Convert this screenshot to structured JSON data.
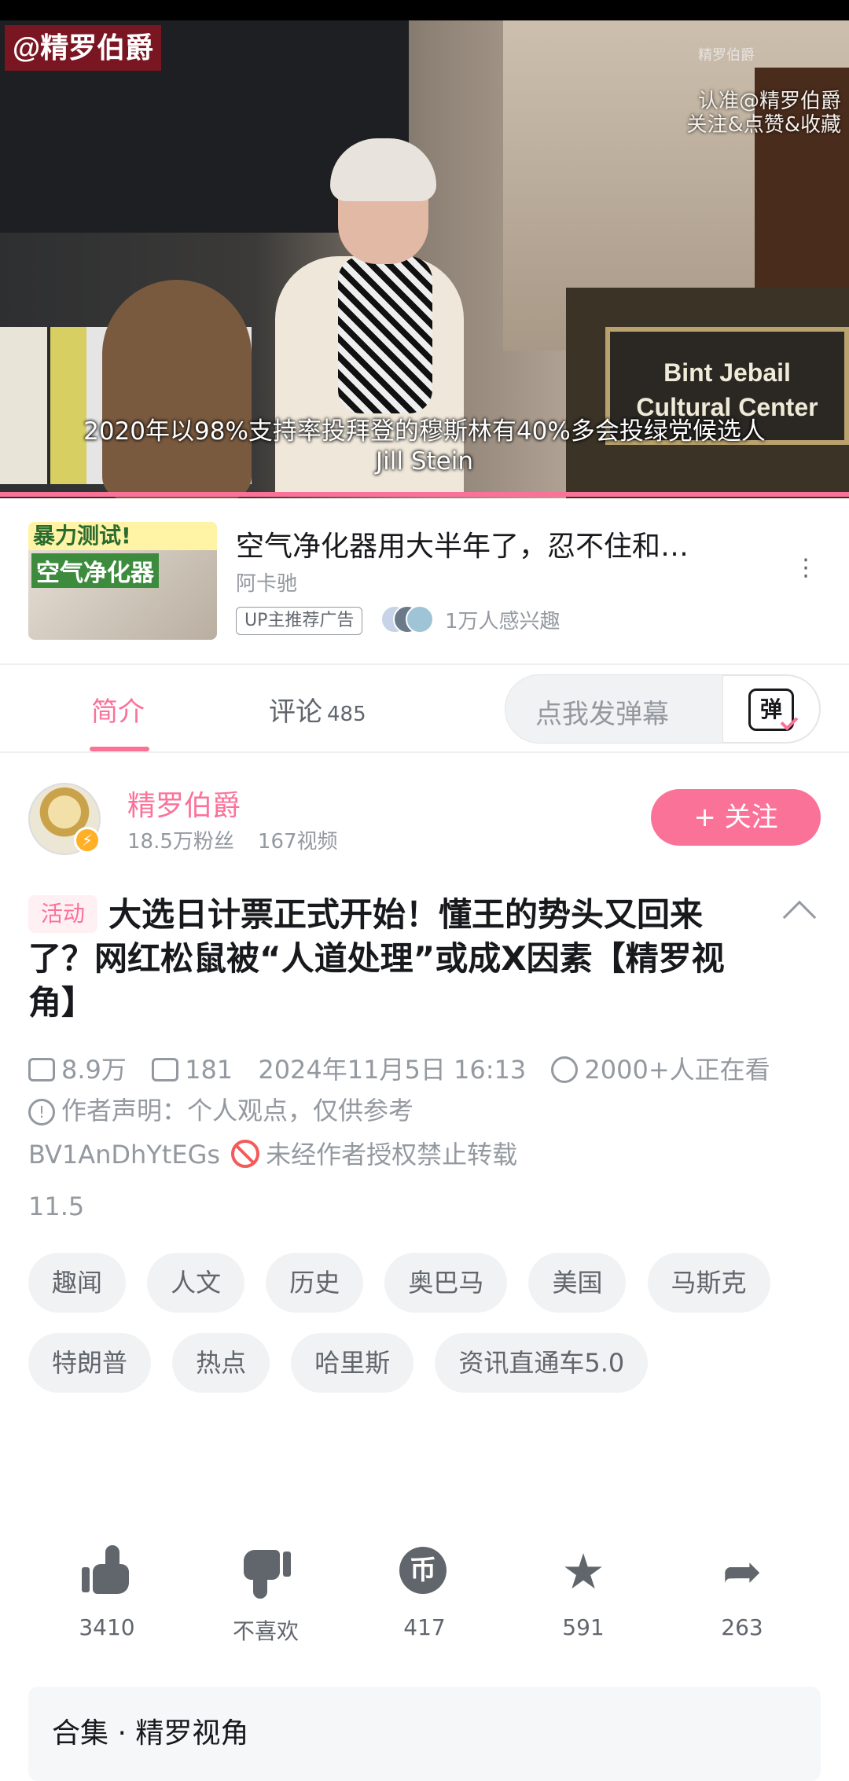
{
  "video": {
    "watermark": "@精罗伯爵",
    "watermark_top_right": "精罗伯爵",
    "watermark_lines": [
      "认准@精罗伯爵",
      "关注&点赞&收藏"
    ],
    "sign_lines": [
      "Bint Jebail",
      "Cultural Center"
    ],
    "subtitle_lines": [
      "2020年以98%支持率投拜登的穆斯林有40%多会投绿党候选人",
      "Jill Stein"
    ],
    "progress": 1.0
  },
  "ad": {
    "thumb_text_1": "暴力测试!",
    "thumb_text_2": "空气净化器",
    "title": "空气净化器用大半年了，忍不住和…",
    "author": "阿卡驰",
    "tag": "UP主推荐广告",
    "interest": "1万人感兴趣",
    "more": "⋮"
  },
  "tabs": {
    "intro": "简介",
    "comments": "评论",
    "comments_count": "485",
    "danmaku_placeholder": "点我发弹幕",
    "danmaku_btn": "弹"
  },
  "author": {
    "name": "精罗伯爵",
    "fans": "18.5万粉丝",
    "videos": "167视频",
    "follow_label": "+ 关注",
    "badge_icon": "⚡"
  },
  "video_info": {
    "activity_badge": "活动",
    "title": "大选日计票正式开始！懂王的势头又回来了？网红松鼠被“人道处理”或成X因素【精罗视角】",
    "views": "8.9万",
    "danmaku_count": "181",
    "datetime": "2024年11月5日 16:13",
    "watching": "2000+人正在看",
    "declaration": "作者声明：个人观点，仅供参考",
    "bvid": "BV1AnDhYtEGs",
    "no_repost": "未经作者授权禁止转载",
    "version": "11.5"
  },
  "tags": [
    "趣闻",
    "人文",
    "历史",
    "奥巴马",
    "美国",
    "马斯克",
    "特朗普",
    "热点",
    "哈里斯",
    "资讯直通车5.0"
  ],
  "actions": {
    "like": "3410",
    "dislike": "不喜欢",
    "coin": "417",
    "favorite": "591",
    "share": "263",
    "coin_glyph": "币"
  },
  "collection": {
    "label": "合集 · 精罗视角"
  },
  "colors": {
    "accent": "#fb7299",
    "gray": "#9499a0"
  }
}
